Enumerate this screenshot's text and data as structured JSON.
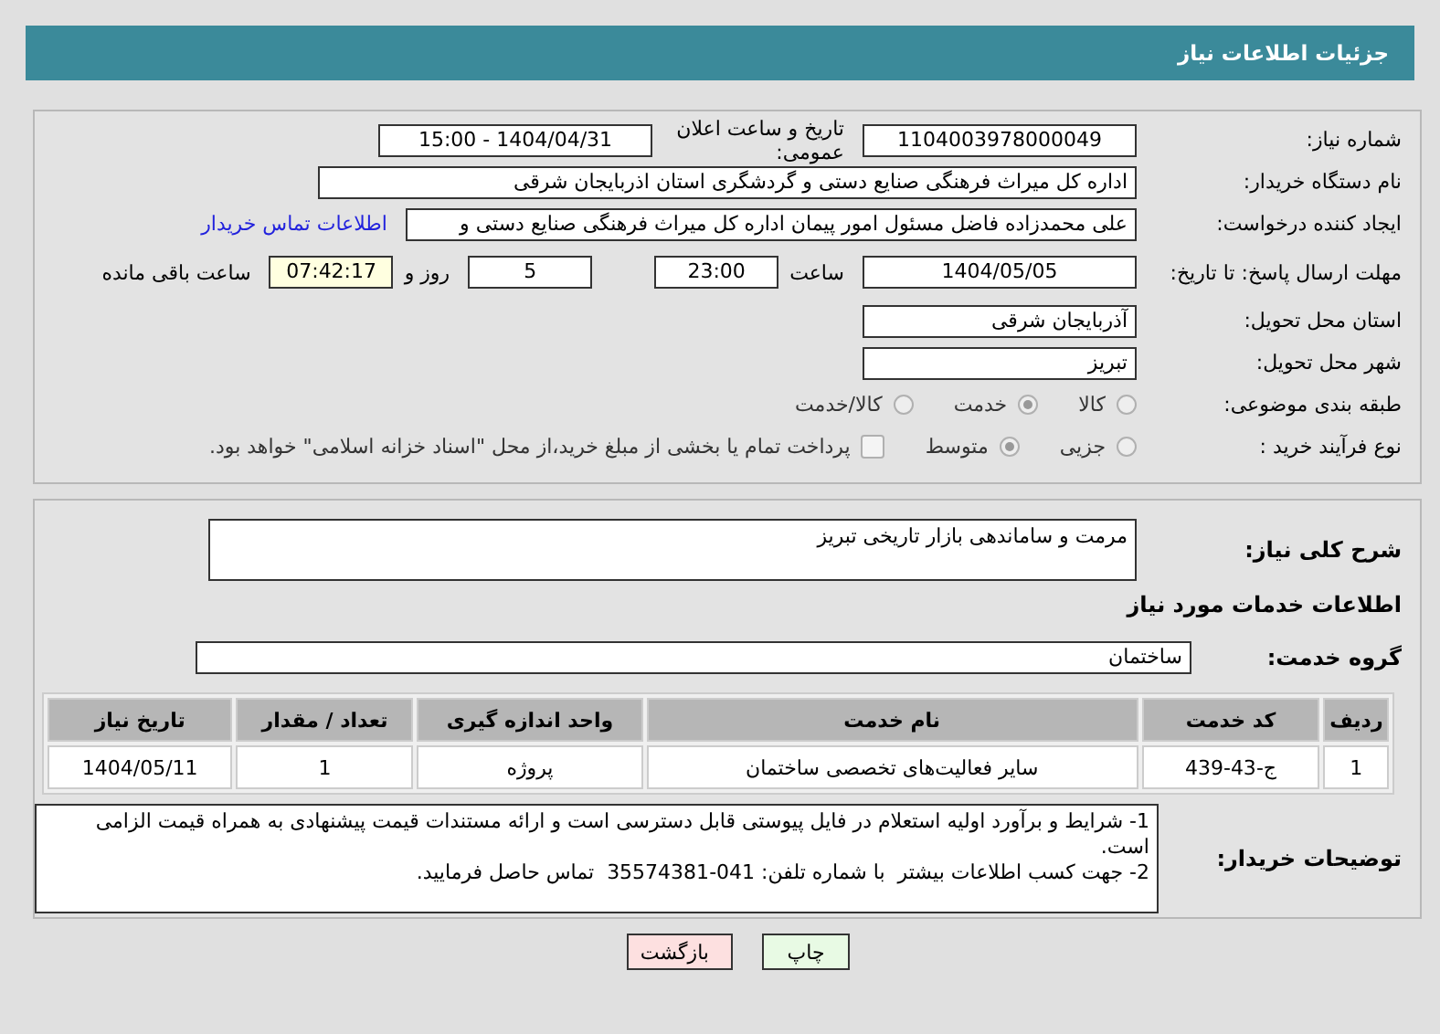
{
  "header": {
    "title": "جزئیات اطلاعات نیاز"
  },
  "need_number": {
    "label": "شماره نیاز:",
    "value": "1104003978000049"
  },
  "announce": {
    "label": "تاریخ و ساعت اعلان عمومی:",
    "value": "1404/04/31 - 15:00"
  },
  "buyer": {
    "label": "نام دستگاه خریدار:",
    "value": "اداره کل میراث فرهنگی  صنایع دستی و گردشگری استان اذربایجان شرقی"
  },
  "creator": {
    "label": "ایجاد کننده درخواست:",
    "value": "علی محمدزاده فاضل مسئول امور پیمان اداره کل میراث فرهنگی  صنایع دستی و",
    "link": "اطلاعات تماس خریدار"
  },
  "deadline": {
    "label": "مهلت ارسال پاسخ: تا تاریخ:",
    "date": "1404/05/05",
    "time_label": "ساعت",
    "time": "23:00",
    "days": "5",
    "days_label": "روز و",
    "remaining": "07:42:17",
    "remaining_label": "ساعت باقی مانده"
  },
  "province": {
    "label": "استان محل تحویل:",
    "value": "آذربایجان شرقی"
  },
  "city": {
    "label": "شهر محل تحویل:",
    "value": "تبریز"
  },
  "category": {
    "label": "طبقه بندی موضوعی:",
    "options": [
      {
        "label": "کالا",
        "selected": false
      },
      {
        "label": "خدمت",
        "selected": true
      },
      {
        "label": "کالا/خدمت",
        "selected": false
      }
    ]
  },
  "process": {
    "label": "نوع فرآیند خرید :",
    "options": [
      {
        "label": "جزیی",
        "selected": false
      },
      {
        "label": "متوسط",
        "selected": true
      }
    ],
    "payment": {
      "checked": false,
      "text": "پرداخت تمام یا بخشی از مبلغ خرید،از محل \"اسناد خزانه اسلامی\" خواهد بود."
    }
  },
  "summary": {
    "label": "شرح کلی نیاز:",
    "value": "مرمت و ساماندهی بازار تاریخی تبریز"
  },
  "services_heading": "اطلاعات خدمات مورد نیاز",
  "service_group": {
    "label": "گروه خدمت:",
    "value": "ساختمان"
  },
  "table": {
    "columns": [
      "ردیف",
      "کد خدمت",
      "نام خدمت",
      "واحد اندازه گیری",
      "تعداد / مقدار",
      "تاریخ نیاز"
    ],
    "rows": [
      [
        "1",
        "ج-43-439",
        "سایر فعالیت‌های تخصصی ساختمان",
        "پروژه",
        "1",
        "1404/05/11"
      ]
    ]
  },
  "notes": {
    "label": "توضیحات خریدار:",
    "value": "1- شرایط و برآورد اولیه استعلام در فایل پیوستی قابل دسترسی است و ارائه مستندات قیمت پیشنهادی به همراه قیمت الزامی است.\n2- جهت کسب اطلاعات بیشتر  با شماره تلفن: 041-35574381  تماس حاصل فرمایید."
  },
  "buttons": [
    {
      "kind": "print",
      "label": "چاپ"
    },
    {
      "kind": "back",
      "label": "بازگشت"
    }
  ]
}
